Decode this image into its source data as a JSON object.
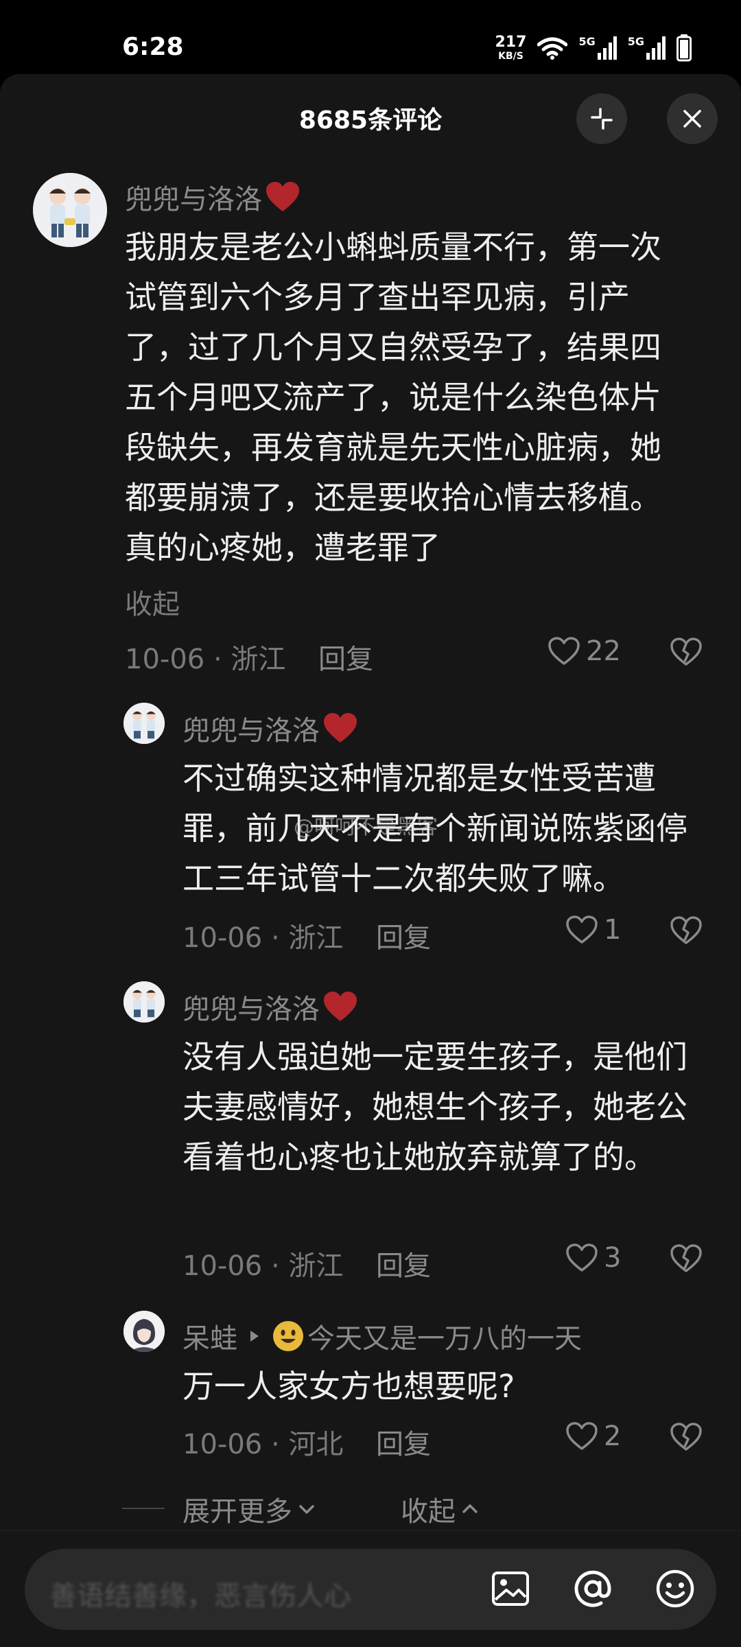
{
  "status_bar": {
    "time": "6:28",
    "net_speed_value": "217",
    "net_speed_unit": "KB/S",
    "signal1_label": "5G",
    "signal2_label": "5G"
  },
  "header": {
    "title": "8685条评论"
  },
  "comments": [
    {
      "username": "兜兜与洛洛",
      "content": "我朋友是老公小蝌蚪质量不行，第一次试管到六个多月了查出罕见病，引产了，过了几个月又自然受孕了，结果四五个月吧又流产了，说是什么染色体片段缺失，再发育就是先天性心脏病，她都要崩溃了，还是要收拾心情去移植。真的心疼她，遭老罪了",
      "collapse_label": "收起",
      "meta": "10-06 · 浙江",
      "reply_label": "回复",
      "likes": "22"
    }
  ],
  "replies": [
    {
      "username": "兜兜与洛洛",
      "content": "不过确实这种情况都是女性受苦遭罪，前几天不是有个新闻说陈紫函停工三年试管十二次都失败了嘛。",
      "meta": "10-06 · 浙江",
      "reply_label": "回复",
      "likes": "1"
    },
    {
      "username": "兜兜与洛洛",
      "content": "没有人强迫她一定要生孩子，是他们夫妻感情好，她想生个孩子，她老公看着也心疼也让她放弃就算了的。",
      "meta": "10-06 · 浙江",
      "reply_label": "回复",
      "likes": "3"
    },
    {
      "username": "呆蛙",
      "reply_to": "今天又是一万八的一天",
      "content": "万一人家女方也想要呢?",
      "meta": "10-06 · 河北",
      "reply_label": "回复",
      "likes": "2"
    }
  ],
  "thread_controls": {
    "expand_more": "展开更多",
    "collapse": "收起"
  },
  "watermark": "@呵呵不是黑客",
  "bottom_bar": {
    "placeholder": "善语结善缘，恶言伤人心"
  },
  "colors": {
    "sheet_bg": "#161616",
    "heart_red": "#b3262b",
    "muted_text": "#8a8a8a"
  }
}
